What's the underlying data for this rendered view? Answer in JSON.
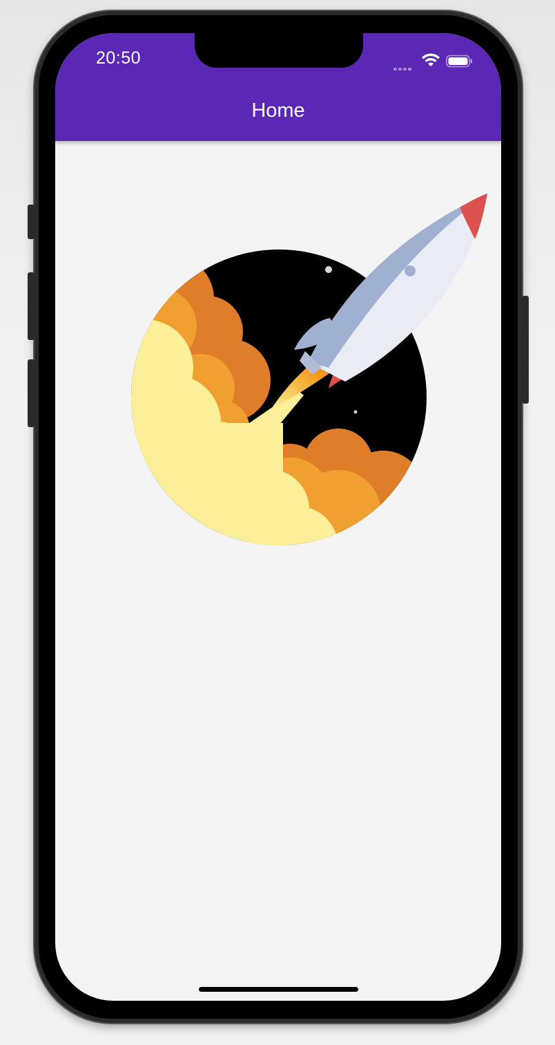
{
  "status_bar": {
    "time": "20:50",
    "icons": [
      "cellular-icon",
      "wifi-icon",
      "battery-icon"
    ]
  },
  "app_bar": {
    "title": "Home",
    "color": "#5a28b4"
  },
  "content": {
    "illustration": "rocket-launch-illustration"
  },
  "colors": {
    "background": "#f4f4f4",
    "space": "#000000",
    "rocket_body": "#e9ecf4",
    "rocket_fin": "#9fb0d0",
    "rocket_accent": "#dd5050",
    "flame": "#f5a020",
    "cloud_light": "#fcef9a",
    "cloud_mid": "#f0a030",
    "cloud_dark": "#e07d28"
  }
}
